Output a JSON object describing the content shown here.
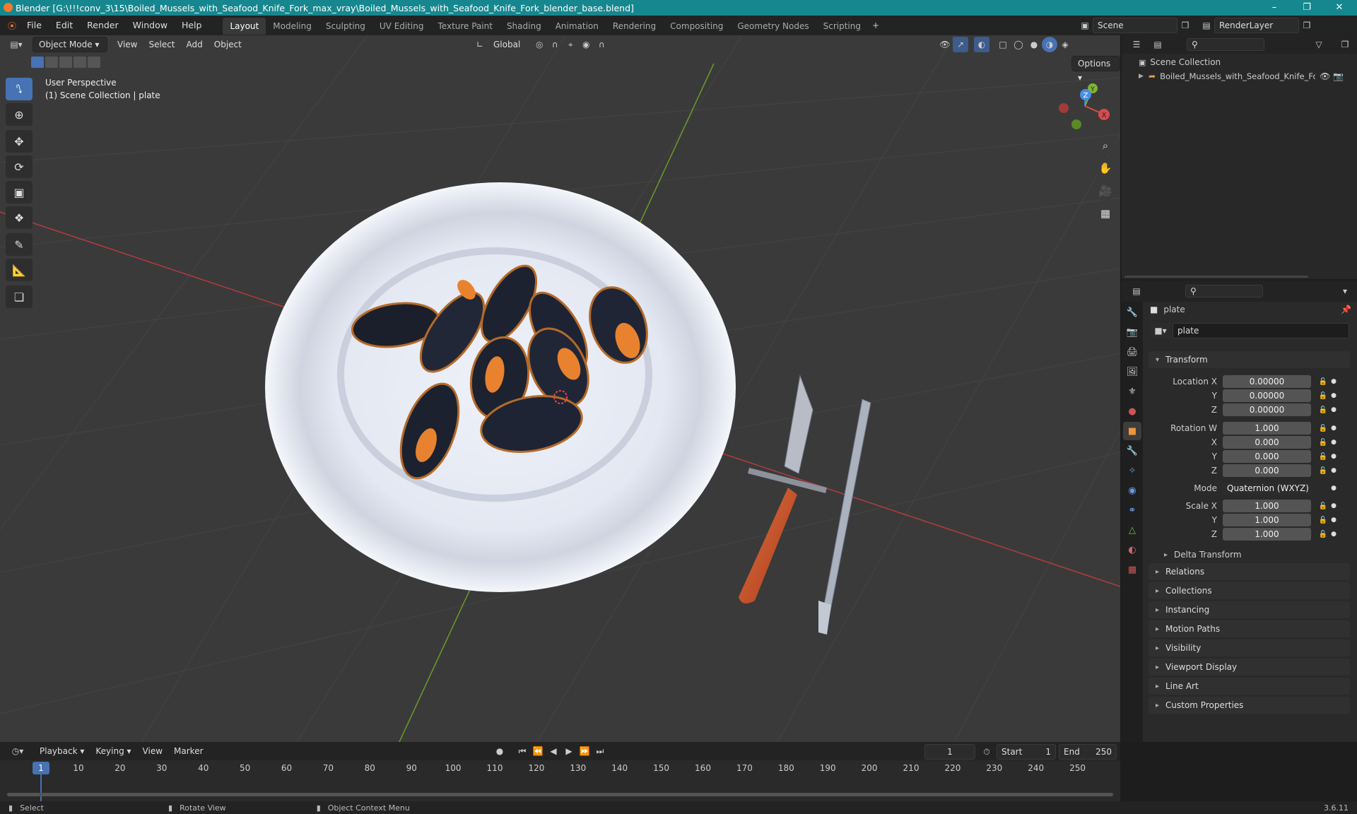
{
  "window": {
    "title": "Blender [G:\\!!!conv_3\\15\\Boiled_Mussels_with_Seafood_Knife_Fork_max_vray\\Boiled_Mussels_with_Seafood_Knife_Fork_blender_base.blend]",
    "controls": [
      "minimize-icon",
      "restore-icon",
      "close-icon"
    ]
  },
  "menu": [
    "File",
    "Edit",
    "Render",
    "Window",
    "Help"
  ],
  "workspaces": [
    "Layout",
    "Modeling",
    "Sculpting",
    "UV Editing",
    "Texture Paint",
    "Shading",
    "Animation",
    "Rendering",
    "Compositing",
    "Geometry Nodes",
    "Scripting"
  ],
  "active_workspace": "Layout",
  "scene_name": "Scene",
  "render_layer": "RenderLayer",
  "viewport": {
    "mode": "Object Mode",
    "menus": [
      "View",
      "Select",
      "Add",
      "Object"
    ],
    "transform_orientation": "Global",
    "options_label": "Options",
    "overlay_line1": "User Perspective",
    "overlay_line2": "(1) Scene Collection | plate",
    "tools": [
      "select-box-icon",
      "cursor-icon",
      "move-icon",
      "rotate-icon",
      "scale-icon",
      "transform-icon",
      "annotate-icon",
      "measure-icon",
      "add-cube-icon"
    ],
    "gizmo": {
      "x": "X",
      "y": "Y",
      "z": "Z"
    }
  },
  "outliner": {
    "root": "Scene Collection",
    "items": [
      {
        "label": "Boiled_Mussels_with_Seafood_Knife_For"
      }
    ]
  },
  "properties": {
    "object_name": "plate",
    "datablock": "plate",
    "transform_title": "Transform",
    "location": {
      "label": "Location X",
      "x": "0.00000",
      "y": "0.00000",
      "z": "0.00000"
    },
    "rotation": {
      "label": "Rotation W",
      "w": "1.000",
      "x": "0.000",
      "y": "0.000",
      "z": "0.000"
    },
    "mode": {
      "label": "Mode",
      "value": "Quaternion (WXYZ)"
    },
    "scale": {
      "label": "Scale X",
      "x": "1.000",
      "y": "1.000",
      "z": "1.000"
    },
    "axis_labels": {
      "y": "Y",
      "z": "Z",
      "x": "X"
    },
    "delta_transform": "Delta Transform",
    "panels": [
      "Relations",
      "Collections",
      "Instancing",
      "Motion Paths",
      "Visibility",
      "Viewport Display",
      "Line Art",
      "Custom Properties"
    ]
  },
  "timeline": {
    "menus": [
      "Playback",
      "Keying",
      "View",
      "Marker"
    ],
    "current_frame": "1",
    "start_label": "Start",
    "start": "1",
    "end_label": "End",
    "end": "250",
    "ticks": [
      "1",
      "10",
      "20",
      "30",
      "40",
      "50",
      "60",
      "70",
      "80",
      "90",
      "100",
      "110",
      "120",
      "130",
      "140",
      "150",
      "160",
      "170",
      "180",
      "190",
      "200",
      "210",
      "220",
      "230",
      "240",
      "250"
    ]
  },
  "statusbar": {
    "left": "Select",
    "middle": "Rotate View",
    "right": "Object Context Menu",
    "version": "3.6.11"
  },
  "colors": {
    "titlebar": "#17878f",
    "accent": "#4772b3",
    "x_axis": "#d84b4b",
    "y_axis": "#7fb32f",
    "z_axis": "#4a8ee8"
  }
}
